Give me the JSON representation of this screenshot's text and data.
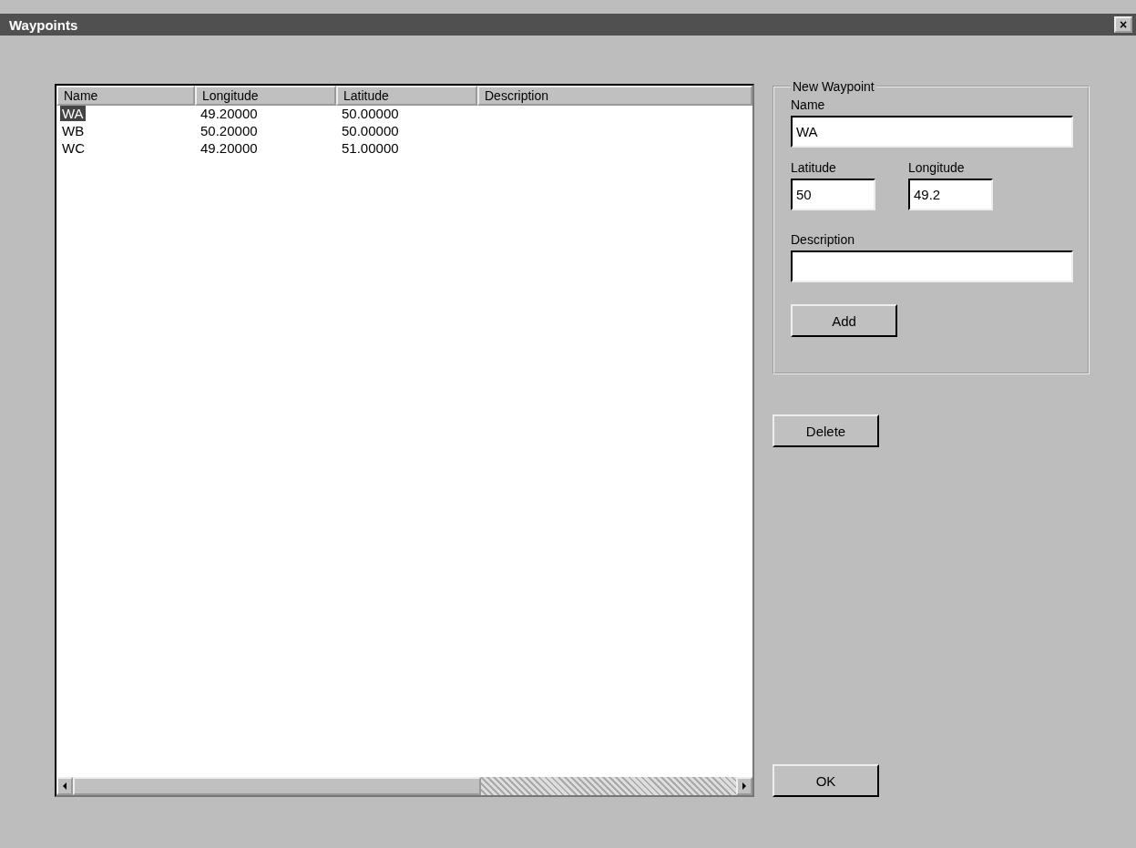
{
  "window": {
    "title": "Waypoints",
    "close_icon": "×"
  },
  "table": {
    "columns": [
      "Name",
      "Longitude",
      "Latitude",
      "Description"
    ],
    "rows": [
      {
        "cells": [
          "WA",
          "49.20000",
          "50.00000"
        ],
        "selected": true
      },
      {
        "cells": [
          "WB",
          "50.20000",
          "50.00000"
        ],
        "selected": false
      },
      {
        "cells": [
          "WC",
          "49.20000",
          "51.00000"
        ],
        "selected": false
      }
    ]
  },
  "new_waypoint": {
    "title": "New Waypoint",
    "name": {
      "label": "Name",
      "value": "WA"
    },
    "latitude": {
      "label": "Latitude",
      "value": "50"
    },
    "longitude": {
      "label": "Longitude",
      "value": "49.2"
    },
    "description": {
      "label": "Description"
    },
    "add_button": "Add"
  },
  "buttons": {
    "delete": "Delete",
    "ok": "OK"
  }
}
